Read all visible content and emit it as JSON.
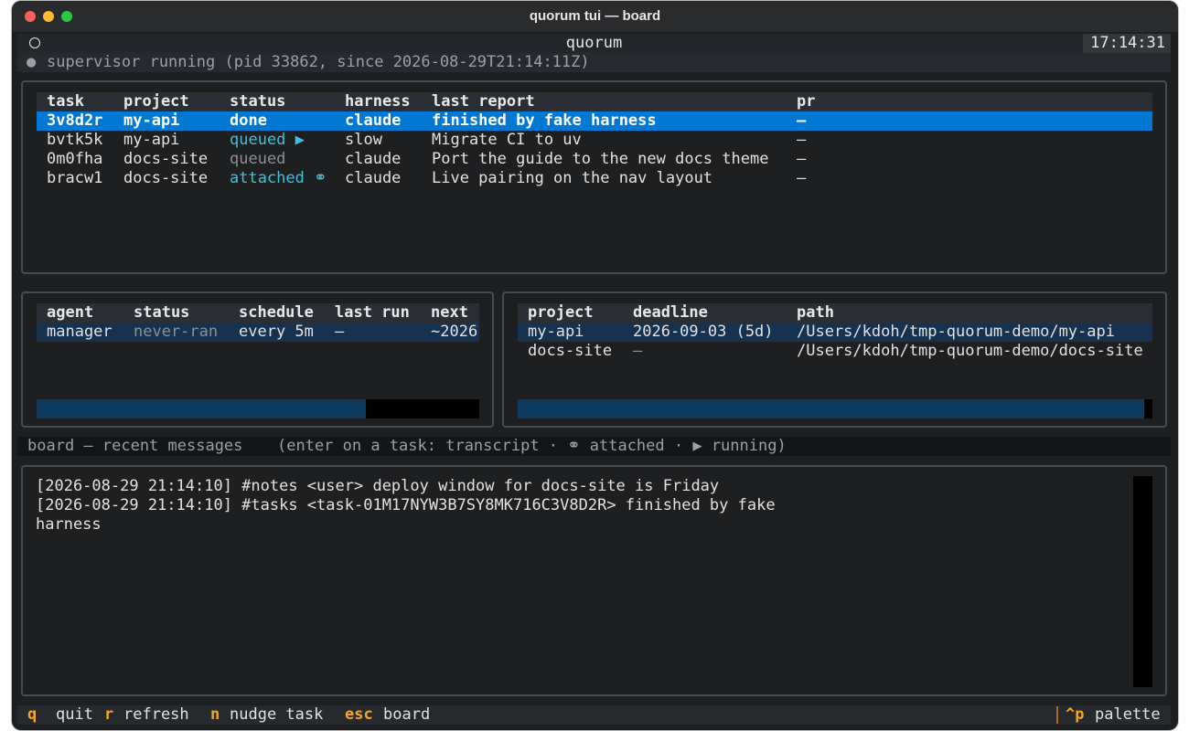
{
  "window": {
    "title": "quorum tui — board"
  },
  "header": {
    "title": "quorum",
    "clock": "17:14:31"
  },
  "supervisor": {
    "status_dot": "●",
    "text": "supervisor running (pid 33862, since 2026-08-29T21:14:11Z)"
  },
  "tasks": {
    "columns": [
      "task",
      "project",
      "status",
      "harness",
      "last report",
      "pr"
    ],
    "rows": [
      {
        "task": "3v8d2r",
        "project": "my-api",
        "status": "done",
        "harness": "claude",
        "last_report": "finished by fake harness",
        "pr": "—"
      },
      {
        "task": "bvtk5k",
        "project": "my-api",
        "status": "queued ▶",
        "harness": "slow",
        "last_report": "Migrate CI to uv",
        "pr": "—"
      },
      {
        "task": "0m0fha",
        "project": "docs-site",
        "status": "queued",
        "harness": "claude",
        "last_report": "Port the guide to the new docs theme",
        "pr": "—"
      },
      {
        "task": "bracw1",
        "project": "docs-site",
        "status": "attached ⚭",
        "harness": "claude",
        "last_report": "Live pairing on the nav layout",
        "pr": "—"
      }
    ]
  },
  "agents": {
    "columns": [
      "agent",
      "status",
      "schedule",
      "last run",
      "next"
    ],
    "rows": [
      {
        "agent": "manager",
        "status": "never-ran",
        "schedule": "every 5m",
        "last_run": "—",
        "next": "~2026"
      }
    ]
  },
  "projects": {
    "columns": [
      "project",
      "deadline",
      "path"
    ],
    "rows": [
      {
        "project": "my-api",
        "deadline": "2026-09-03 (5d)",
        "path": "/Users/kdoh/tmp-quorum-demo/my-api"
      },
      {
        "project": "docs-site",
        "deadline": "—",
        "path": "/Users/kdoh/tmp-quorum-demo/docs-site"
      }
    ]
  },
  "messages": {
    "title": "board — recent messages",
    "hint": "(enter on a task: transcript · ⚭ attached · ▶ running)",
    "lines": [
      "[2026-08-29 21:14:10] #notes <user> deploy window for docs-site is Friday",
      "[2026-08-29 21:14:10] #tasks <task-01M17NYW3B7SY8MK716C3V8D2R> finished by fake",
      "harness"
    ]
  },
  "footer": {
    "bindings": [
      {
        "key": "q",
        "label": "quit"
      },
      {
        "key": "r",
        "label": "refresh"
      },
      {
        "key": "n",
        "label": "nudge task"
      },
      {
        "key": "esc",
        "label": "board"
      }
    ],
    "palette": {
      "key": "^p",
      "label": "palette"
    }
  },
  "colors": {
    "selection": "#0178d4",
    "accent_key": "#f5a623",
    "cyan": "#3ec1dd"
  }
}
